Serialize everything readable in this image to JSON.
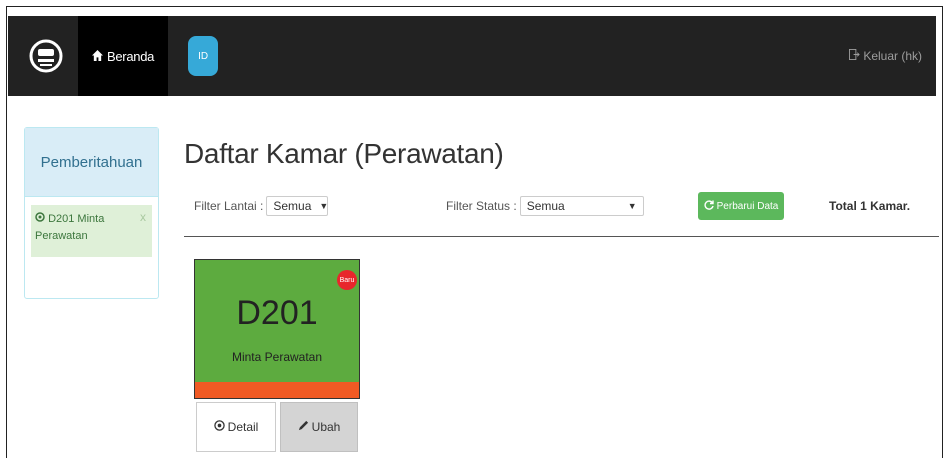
{
  "navbar": {
    "home_label": "Beranda",
    "id_label": "ID",
    "logout_label": "Keluar (hk)"
  },
  "notice": {
    "title": "Pemberitahuan",
    "item_text": "D201 Minta Perawatan",
    "close_label": "x"
  },
  "main": {
    "title": "Daftar Kamar (Perawatan)"
  },
  "filters": {
    "floor_label": "Filter Lantai :",
    "floor_value": "Semua",
    "status_label": "Filter Status :",
    "status_value": "Semua",
    "refresh_label": "Perbarui Data",
    "total_text": "Total 1 Kamar."
  },
  "room": {
    "number": "D201",
    "status": "Minta Perawatan",
    "badge": "Baru",
    "detail_label": "Detail",
    "edit_label": "Ubah"
  },
  "colors": {
    "navbar": "#222222",
    "room_card": "#5dab3f",
    "room_bar": "#f05a24",
    "badge": "#e8262c",
    "refresh_button": "#5cb85c",
    "id_chip": "#36a9d8"
  },
  "icons": {
    "brand": "logo-icon",
    "home": "home-icon",
    "logout": "logout-icon",
    "notice_item": "check-circle-icon",
    "refresh": "refresh-icon",
    "detail": "eye-icon",
    "edit": "pencil-icon"
  }
}
